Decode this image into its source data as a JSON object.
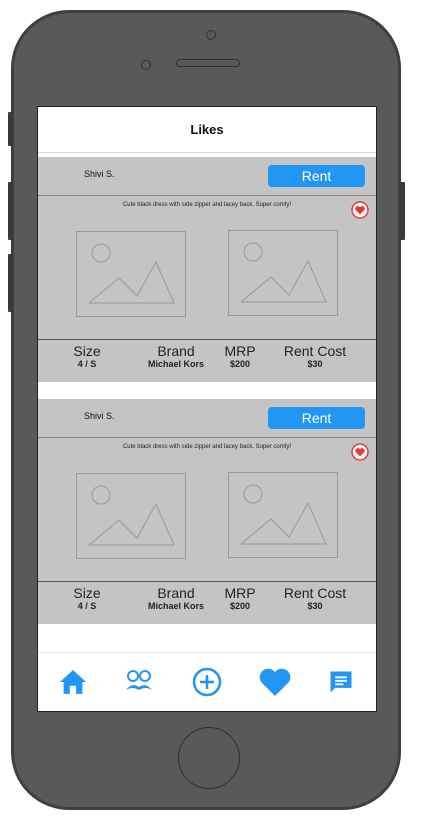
{
  "header": {
    "title": "Likes"
  },
  "cards": [
    {
      "user_name": "Shivi S.",
      "rent_label": "Rent",
      "description": "Cute black dress with side zipper and lacey back. Super comfy!",
      "stats": {
        "size_label": "Size",
        "size_value": "4 / S",
        "brand_label": "Brand",
        "brand_value": "Michael Kors",
        "mrp_label": "MRP",
        "mrp_value": "$200",
        "rent_cost_label": "Rent Cost",
        "rent_cost_value": "$30"
      }
    },
    {
      "user_name": "Shivi S.",
      "rent_label": "Rent",
      "description": "Cute black dress with side zipper and lacey back. Super comfy!",
      "stats": {
        "size_label": "Size",
        "size_value": "4 / S",
        "brand_label": "Brand",
        "brand_value": "Michael Kors",
        "mrp_label": "MRP",
        "mrp_value": "$200",
        "rent_cost_label": "Rent Cost",
        "rent_cost_value": "$30"
      }
    }
  ],
  "tabbar": {
    "icons": [
      "home-icon",
      "glasses-mustache-icon",
      "add-circle-icon",
      "heart-icon",
      "chat-icon"
    ]
  },
  "colors": {
    "accent": "#2196f3",
    "card_bg": "#c4c4c4",
    "heart_badge": "#e53935",
    "phone_body": "#595959"
  }
}
